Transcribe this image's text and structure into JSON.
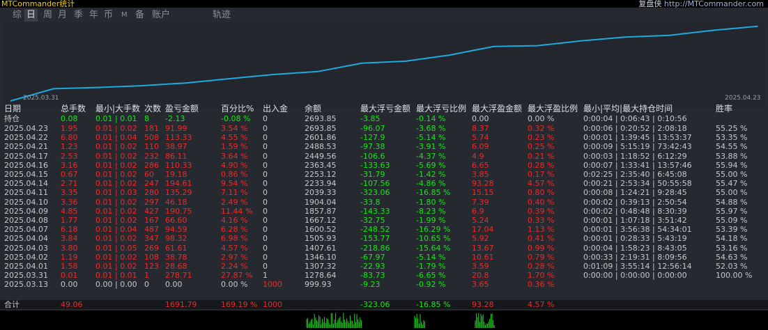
{
  "title": {
    "left": "MTCommander统计",
    "right_prefix": "复盘侠 ",
    "right_url": "http://MTCommander.com"
  },
  "tabs": [
    "综",
    "日",
    "周",
    "月",
    "季",
    "年",
    "币",
    "M",
    "备",
    "账户",
    "轨迹"
  ],
  "active_tab": "日",
  "chart": {
    "start_label": "2025.03.31",
    "end_label": "2025.04.23",
    "line_color": "#1eaadf",
    "x": [
      "2025.03.31",
      "2025.04.01",
      "2025.04.02",
      "2025.04.03",
      "2025.04.04",
      "2025.04.07",
      "2025.04.08",
      "2025.04.09",
      "2025.04.10",
      "2025.04.11",
      "2025.04.14",
      "2025.04.15",
      "2025.04.16",
      "2025.04.17",
      "2025.04.21",
      "2025.04.22",
      "2025.04.23"
    ],
    "y": [
      278.71,
      307.39,
      346.17,
      407.78,
      506.1,
      600.69,
      667.29,
      857.04,
      903.22,
      1042.51,
      1237.12,
      1256.3,
      1366.63,
      1452.74,
      1491.71,
      1605.24,
      1697.15
    ]
  },
  "headers": {
    "date": "日期",
    "lots": "总手数",
    "minmax": "最小|大手数",
    "count": "次数",
    "pnl": "盈亏金额",
    "pct": "百分比%",
    "io": "出入金",
    "bal": "余额",
    "mfl": "最大浮亏金额",
    "mflp": "最大浮亏比例",
    "mfp": "最大浮盈金额",
    "mfpp": "最大浮盈比例",
    "time": "最小|平均|最大持仓时间",
    "win": "胜率"
  },
  "holding": {
    "date": "持仓",
    "lots": "0.08",
    "minmax": "0.01 | 0.01",
    "count": "8",
    "pnl": "-2.13",
    "pct": "-0.08 %",
    "io": "0",
    "bal": "2693.85",
    "mfl": "-3.85",
    "mflp": "-0.14 %",
    "mfp": "0.00",
    "mfpp": "0.00 %",
    "time": "0:00:04 | 0:06:43 | 0:10:56",
    "win": ""
  },
  "rows": [
    {
      "date": "2025.04.23",
      "lots": "1.95",
      "minmax": "0.01 | 0.02",
      "count": "181",
      "pnl": "91.99",
      "pct": "3.54 %",
      "io": "0",
      "bal": "2693.85",
      "mfl": "-96.07",
      "mflp": "-3.68 %",
      "mfp": "8.37",
      "mfpp": "0.32 %",
      "time": "0:00:06 | 0:20:52 | 2:08:18",
      "win": "55.25 %"
    },
    {
      "date": "2025.04.22",
      "lots": "6.80",
      "minmax": "0.01 | 0.04",
      "count": "508",
      "pnl": "113.33",
      "pct": "4.55 %",
      "io": "0",
      "bal": "2601.86",
      "mfl": "-127.9",
      "mflp": "-5.14 %",
      "mfp": "5.74",
      "mfpp": "0.23 %",
      "time": "0:00:01 | 1:39:45 | 13:53:37",
      "win": "53.35 %"
    },
    {
      "date": "2025.04.21",
      "lots": "1.23",
      "minmax": "0.01 | 0.02",
      "count": "110",
      "pnl": "38.97",
      "pct": "1.59 %",
      "io": "0",
      "bal": "2488.53",
      "mfl": "-97.38",
      "mflp": "-3.91 %",
      "mfp": "6.09",
      "mfpp": "0.25 %",
      "time": "0:00:09 | 5:15:19 | 73:42:43",
      "win": "54.55 %"
    },
    {
      "date": "2025.04.17",
      "lots": "2.53",
      "minmax": "0.01 | 0.02",
      "count": "232",
      "pnl": "86.11",
      "pct": "3.64 %",
      "io": "0",
      "bal": "2449.56",
      "mfl": "-106.6",
      "mflp": "-4.37 %",
      "mfp": "4.9",
      "mfpp": "0.21 %",
      "time": "0:00:03 | 1:18:52 | 6:12:29",
      "win": "53.88 %"
    },
    {
      "date": "2025.04.16",
      "lots": "3.16",
      "minmax": "0.01 | 0.02",
      "count": "286",
      "pnl": "110.33",
      "pct": "4.90 %",
      "io": "0",
      "bal": "2363.45",
      "mfl": "-133.63",
      "mflp": "-5.69 %",
      "mfp": "6.65",
      "mfpp": "0.28 %",
      "time": "0:00:07 | 1:33:41 | 13:57:46",
      "win": "55.94 %"
    },
    {
      "date": "2025.04.15",
      "lots": "0.67",
      "minmax": "0.01 | 0.02",
      "count": "60",
      "pnl": "19.18",
      "pct": "0.86 %",
      "io": "0",
      "bal": "2253.12",
      "mfl": "-31.79",
      "mflp": "-1.42 %",
      "mfp": "3.85",
      "mfpp": "0.17 %",
      "time": "0:02:25 | 2:35:40 | 6:45:08",
      "win": "55.00 %"
    },
    {
      "date": "2025.04.14",
      "lots": "2.71",
      "minmax": "0.01 | 0.02",
      "count": "247",
      "pnl": "194.61",
      "pct": "9.54 %",
      "io": "0",
      "bal": "2233.94",
      "mfl": "-107.56",
      "mflp": "-4.86 %",
      "mfp": "93.28",
      "mfpp": "4.57 %",
      "time": "0:00:21 | 2:53:34 | 50:55:58",
      "win": "55.47 %"
    },
    {
      "date": "2025.04.11",
      "lots": "3.35",
      "minmax": "0.01 | 0.03",
      "count": "280",
      "pnl": "135.29",
      "pct": "7.11 %",
      "io": "0",
      "bal": "2039.33",
      "mfl": "-323.06",
      "mflp": "-16.85 %",
      "mfp": "15.15",
      "mfpp": "0.80 %",
      "time": "0:00:08 | 1:24:21 | 9:28:45",
      "win": "55.00 %"
    },
    {
      "date": "2025.04.10",
      "lots": "3.36",
      "minmax": "0.01 | 0.02",
      "count": "297",
      "pnl": "46.18",
      "pct": "2.49 %",
      "io": "0",
      "bal": "1904.04",
      "mfl": "-33.8",
      "mflp": "-1.80 %",
      "mfp": "7.39",
      "mfpp": "0.40 %",
      "time": "0:00:02 | 0:39:13 | 2:50:54",
      "win": "54.88 %"
    },
    {
      "date": "2025.04.09",
      "lots": "4.85",
      "minmax": "0.01 | 0.02",
      "count": "427",
      "pnl": "190.75",
      "pct": "11.44 %",
      "io": "0",
      "bal": "1857.87",
      "mfl": "-143.33",
      "mflp": "-8.23 %",
      "mfp": "6.9",
      "mfpp": "0.39 %",
      "time": "0:00:02 | 0:48:48 | 8:30:39",
      "win": "55.97 %"
    },
    {
      "date": "2025.04.08",
      "lots": "1.77",
      "minmax": "0.01 | 0.02",
      "count": "167",
      "pnl": "66.60",
      "pct": "4.16 %",
      "io": "0",
      "bal": "1667.12",
      "mfl": "-32.75",
      "mflp": "-1.99 %",
      "mfp": "5.24",
      "mfpp": "0.33 %",
      "time": "0:00:01 | 1:07:18 | 3:51:42",
      "win": "55.09 %"
    },
    {
      "date": "2025.04.07",
      "lots": "6.18",
      "minmax": "0.01 | 0.04",
      "count": "487",
      "pnl": "94.59",
      "pct": "6.28 %",
      "io": "0",
      "bal": "1600.52",
      "mfl": "-248.52",
      "mflp": "-16.29 %",
      "mfp": "17.04",
      "mfpp": "1.13 %",
      "time": "0:00:01 | 3:56:38 | 54:34:01",
      "win": "53.39 %"
    },
    {
      "date": "2025.04.04",
      "lots": "3.84",
      "minmax": "0.01 | 0.02",
      "count": "347",
      "pnl": "98.32",
      "pct": "6.98 %",
      "io": "0",
      "bal": "1505.93",
      "mfl": "-153.77",
      "mflp": "-10.65 %",
      "mfp": "5.92",
      "mfpp": "0.41 %",
      "time": "0:00:01 | 0:28:33 | 5:43:19",
      "win": "54.18 %"
    },
    {
      "date": "2025.04.03",
      "lots": "3.80",
      "minmax": "0.01 | 0.05",
      "count": "269",
      "pnl": "61.61",
      "pct": "4.57 %",
      "io": "0",
      "bal": "1407.61",
      "mfl": "-218.86",
      "mflp": "-15.64 %",
      "mfp": "13.67",
      "mfpp": "0.99 %",
      "time": "0:00:04 | 1:58:23 | 8:43:05",
      "win": "53.16 %"
    },
    {
      "date": "2025.04.02",
      "lots": "1.19",
      "minmax": "0.01 | 0.02",
      "count": "108",
      "pnl": "38.78",
      "pct": "2.97 %",
      "io": "0",
      "bal": "1346.10",
      "mfl": "-67.97",
      "mflp": "-5.14 %",
      "mfp": "10.61",
      "mfpp": "0.79 %",
      "time": "0:00:33 | 2:19:31 | 8:09:56",
      "win": "54.63 %"
    },
    {
      "date": "2025.04.01",
      "lots": "1.58",
      "minmax": "0.01 | 0.02",
      "count": "123",
      "pnl": "28.68",
      "pct": "2.24 %",
      "io": "0",
      "bal": "1307.32",
      "mfl": "-22.93",
      "mflp": "-1.79 %",
      "mfp": "3.59",
      "mfpp": "0.28 %",
      "time": "0:01:09 | 3:55:14 | 12:56:14",
      "win": "52.03 %"
    },
    {
      "date": "2025.03.31",
      "lots": "0.01",
      "minmax": "0.01 | 0.01",
      "count": "1",
      "pnl": "278.71",
      "pct": "27.87 %",
      "io": "1",
      "bal": "1278.64",
      "mfl": "-83.73",
      "mflp": "-6.65 %",
      "mfp": "20.8",
      "mfpp": "1.70 %",
      "time": "0:00:00 | 0:00:00 | 0:00:00",
      "win": "100.00 %"
    },
    {
      "date": "2025.03.13",
      "lots": "0.00",
      "minmax": "0.00 | 0.00",
      "count": "0",
      "pnl": "0.00",
      "pct": "0.00 %",
      "io": "1000",
      "bal": "999.93",
      "mfl": "-9.23",
      "mflp": "-0.92 %",
      "mfp": "3.65",
      "mfpp": "0.36 %",
      "time": "",
      "win": ""
    }
  ],
  "total": {
    "date": "合计",
    "lots": "49.06",
    "pnl": "1691.79",
    "pct": "169.19 %",
    "io": "1000",
    "mfl": "-323.06",
    "mflp": "-16.85 %",
    "mfp": "93.28",
    "mfpp": "4.57 %"
  }
}
